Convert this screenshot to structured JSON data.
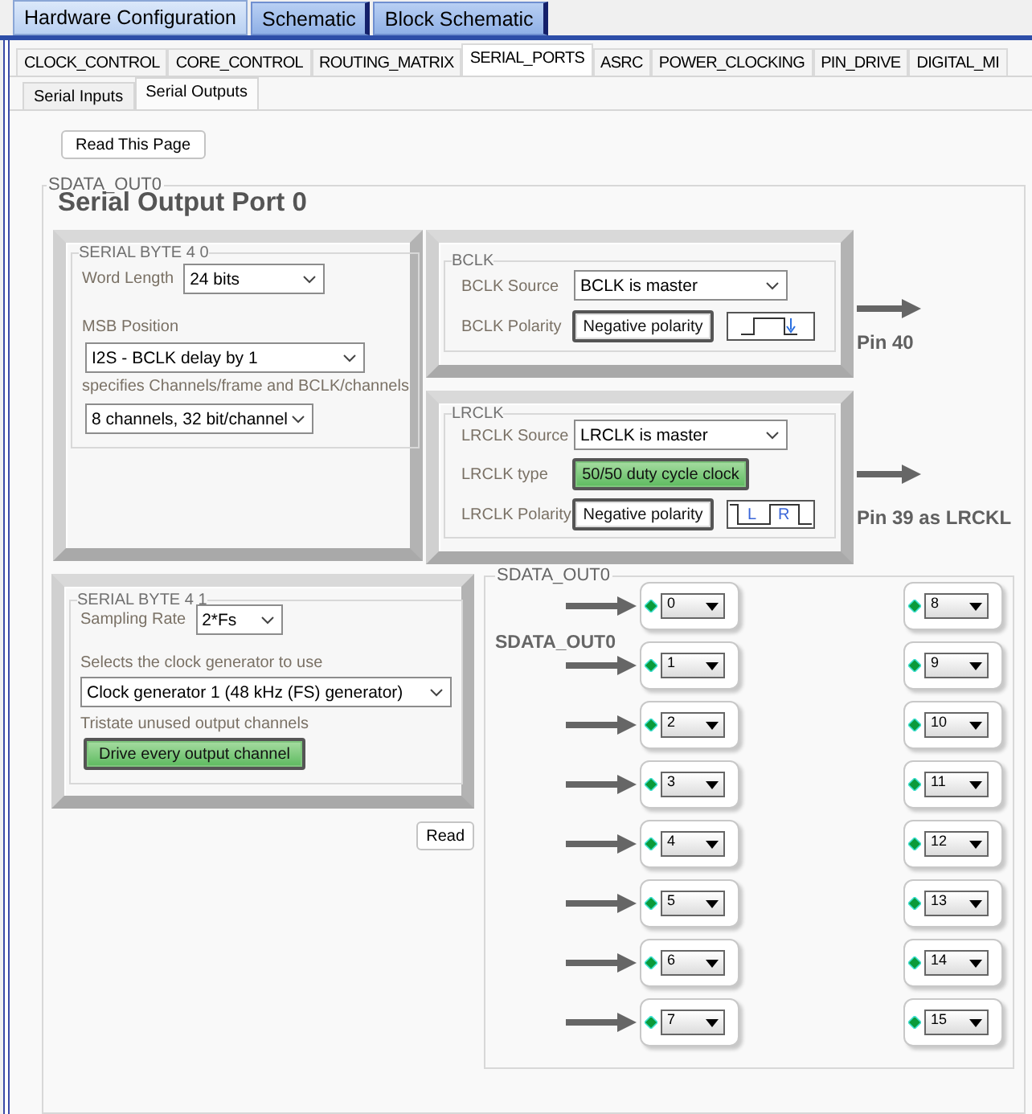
{
  "top_tabs": [
    {
      "label": "Hardware Configuration",
      "selected": true
    },
    {
      "label": "Schematic",
      "selected": false
    },
    {
      "label": "Block Schematic",
      "selected": false
    }
  ],
  "section_tabs": [
    {
      "label": "CLOCK_CONTROL",
      "selected": false
    },
    {
      "label": "CORE_CONTROL",
      "selected": false
    },
    {
      "label": "ROUTING_MATRIX",
      "selected": false
    },
    {
      "label": "SERIAL_PORTS",
      "selected": true
    },
    {
      "label": "ASRC",
      "selected": false
    },
    {
      "label": "POWER_CLOCKING",
      "selected": false
    },
    {
      "label": "PIN_DRIVE",
      "selected": false
    },
    {
      "label": "DIGITAL_MI",
      "selected": false
    }
  ],
  "sub_tabs": [
    {
      "label": "Serial Inputs",
      "selected": false
    },
    {
      "label": "Serial Outputs",
      "selected": true
    }
  ],
  "read_page_button": "Read This Page",
  "group_title": "SDATA_OUT0",
  "heading": "Serial Output Port 0",
  "serial_byte_0": {
    "title": "SERIAL BYTE 4 0",
    "word_length_label": "Word Length",
    "word_length": "24 bits",
    "msb_label": "MSB Position",
    "msb": "I2S - BCLK delay by 1",
    "channels_label": "specifies Channels/frame and BCLK/channels",
    "channels": "8 channels, 32 bit/channel"
  },
  "bclk": {
    "title": "BCLK",
    "source_label": "BCLK Source",
    "source": "BCLK is master",
    "polarity_label": "BCLK Polarity",
    "polarity": {
      "label": "Negative polarity",
      "on": false
    },
    "pin": "Pin 40"
  },
  "lrclk": {
    "title": "LRCLK",
    "source_label": "LRCLK Source",
    "source": "LRCLK is master",
    "type_label": "LRCLK type",
    "type": {
      "label": "50/50 duty cycle clock",
      "on": true
    },
    "polarity_label": "LRCLK Polarity",
    "polarity": {
      "label": "Negative polarity",
      "on": false
    },
    "wave_letters": [
      "L",
      "R"
    ],
    "pin": "Pin 39 as LRCKL"
  },
  "serial_byte_1": {
    "title": "SERIAL BYTE 4 1",
    "sampling_label": "Sampling Rate",
    "sampling": "2*Fs",
    "clock_label": "Selects the clock generator to use",
    "clock": "Clock generator 1 (48 kHz (FS) generator)",
    "tristate_label": "Tristate unused output channels",
    "tristate": {
      "label": "Drive every output channel",
      "on": true
    }
  },
  "read_button": "Read",
  "sdata": {
    "title": "SDATA_OUT0",
    "label": "SDATA_OUT0",
    "left_slots": [
      {
        "value": "0",
        "connected": true
      },
      {
        "value": "1",
        "connected": true
      },
      {
        "value": "2",
        "connected": true
      },
      {
        "value": "3",
        "connected": true
      },
      {
        "value": "4",
        "connected": true
      },
      {
        "value": "5",
        "connected": true
      },
      {
        "value": "6",
        "connected": true
      },
      {
        "value": "7",
        "connected": true
      }
    ],
    "right_slots": [
      {
        "value": "8",
        "connected": false
      },
      {
        "value": "9",
        "connected": false
      },
      {
        "value": "10",
        "connected": false
      },
      {
        "value": "11",
        "connected": false
      },
      {
        "value": "12",
        "connected": false
      },
      {
        "value": "13",
        "connected": false
      },
      {
        "value": "14",
        "connected": false
      },
      {
        "value": "15",
        "connected": false
      }
    ]
  }
}
